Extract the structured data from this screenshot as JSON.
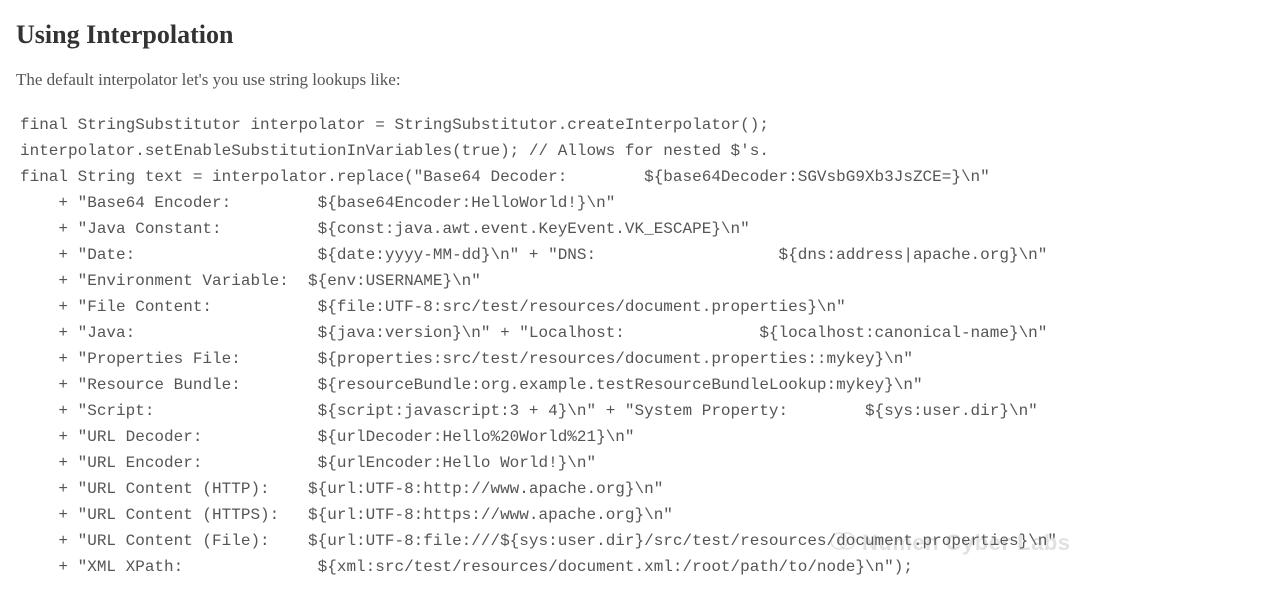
{
  "heading": "Using Interpolation",
  "intro": "The default interpolator let's you use string lookups like:",
  "code_lines": [
    "final StringSubstitutor interpolator = StringSubstitutor.createInterpolator();",
    "interpolator.setEnableSubstitutionInVariables(true); // Allows for nested $'s.",
    "final String text = interpolator.replace(\"Base64 Decoder:        ${base64Decoder:SGVsbG9Xb3JsZCE=}\\n\"",
    "    + \"Base64 Encoder:         ${base64Encoder:HelloWorld!}\\n\"",
    "    + \"Java Constant:          ${const:java.awt.event.KeyEvent.VK_ESCAPE}\\n\"",
    "    + \"Date:                   ${date:yyyy-MM-dd}\\n\" + \"DNS:                   ${dns:address|apache.org}\\n\"",
    "    + \"Environment Variable:  ${env:USERNAME}\\n\"",
    "    + \"File Content:           ${file:UTF-8:src/test/resources/document.properties}\\n\"",
    "    + \"Java:                   ${java:version}\\n\" + \"Localhost:              ${localhost:canonical-name}\\n\"",
    "    + \"Properties File:        ${properties:src/test/resources/document.properties::mykey}\\n\"",
    "    + \"Resource Bundle:        ${resourceBundle:org.example.testResourceBundleLookup:mykey}\\n\"",
    "    + \"Script:                 ${script:javascript:3 + 4}\\n\" + \"System Property:        ${sys:user.dir}\\n\"",
    "    + \"URL Decoder:            ${urlDecoder:Hello%20World%21}\\n\"",
    "    + \"URL Encoder:            ${urlEncoder:Hello World!}\\n\"",
    "    + \"URL Content (HTTP):    ${url:UTF-8:http://www.apache.org}\\n\"",
    "    + \"URL Content (HTTPS):   ${url:UTF-8:https://www.apache.org}\\n\"",
    "    + \"URL Content (File):    ${url:UTF-8:file:///${sys:user.dir}/src/test/resources/document.properties}\\n\"",
    "    + \"XML XPath:              ${xml:src/test/resources/document.xml:/root/path/to/node}\\n\");"
  ],
  "watermark": "Numen Cyber Labs"
}
